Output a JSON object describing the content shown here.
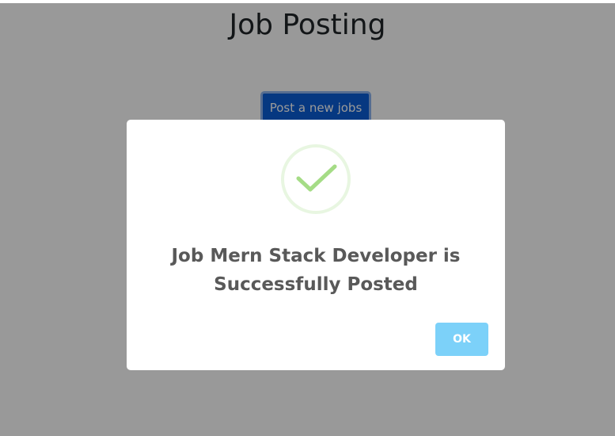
{
  "page": {
    "title": "Job Posting",
    "post_button_label": "Post a new jobs"
  },
  "modal": {
    "icon": "success-check-icon",
    "message_line1": "Job Mern Stack Developer is",
    "message_line2": "Successfully Posted",
    "ok_label": "OK"
  },
  "colors": {
    "overlay": "rgba(0,0,0,0.4)",
    "primary_button": "#0b5ed7",
    "ok_button": "#7cd1f9",
    "success_check": "#a5dc86"
  }
}
